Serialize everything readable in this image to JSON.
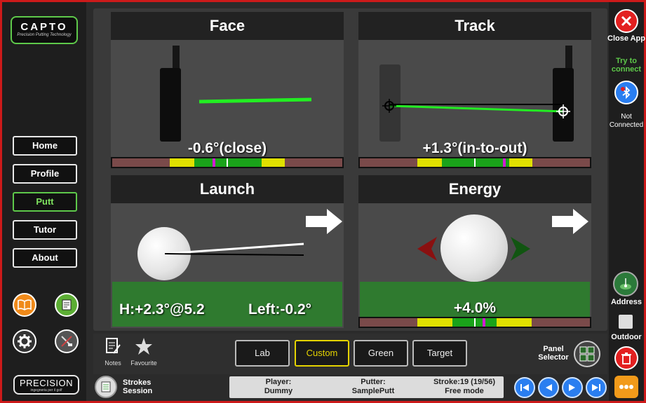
{
  "sidebar": {
    "logo": {
      "brand": "CAPTO",
      "tagline": "Precision Putting Technology"
    },
    "nav": [
      {
        "label": "Home",
        "active": false
      },
      {
        "label": "Profile",
        "active": false
      },
      {
        "label": "Putt",
        "active": true
      },
      {
        "label": "Tutor",
        "active": false
      },
      {
        "label": "About",
        "active": false
      }
    ],
    "footer_logo": {
      "brand": "PRECISION",
      "tagline": "ingegneria per il golf"
    }
  },
  "panels": {
    "face": {
      "title": "Face",
      "value": "-0.6°(close)"
    },
    "track": {
      "title": "Track",
      "value": "+1.3°(in-to-out)"
    },
    "launch": {
      "title": "Launch",
      "value_h": "H:+2.3°@5.2",
      "value_left": "Left:-0.2°"
    },
    "energy": {
      "title": "Energy",
      "value": "+4.0%"
    }
  },
  "toolbar": {
    "notes_label": "Notes",
    "favourite_label": "Favourite",
    "tabs": [
      {
        "label": "Lab",
        "active": false
      },
      {
        "label": "Custom",
        "active": true
      },
      {
        "label": "Green",
        "active": false
      },
      {
        "label": "Target",
        "active": false
      }
    ],
    "panel_selector_label": "Panel Selector"
  },
  "session": {
    "label": "Strokes Session"
  },
  "info": {
    "player_label": "Player:",
    "player_value": "Dummy",
    "putter_label": "Putter:",
    "putter_value": "SamplePutt",
    "stroke_label": "Stroke:19 (19/56)",
    "mode_value": "Free mode"
  },
  "right": {
    "close_label": "Close App",
    "try_connect_label": "Try to connect",
    "status_label": "Not Connected",
    "address_label": "Address",
    "outdoor_label": "Outdoor"
  },
  "colors": {
    "accent_green": "#5ec94a",
    "frame_red": "#cc1a1a",
    "bar_yellow": "#e0e000",
    "bar_green": "#1aa31a",
    "bar_red": "#7a4a4a",
    "marker_magenta": "#d21ad2",
    "nav_blue": "#2a7ef0",
    "highlight_yellow": "#e5d400"
  },
  "icons": {
    "notes": "notes-icon",
    "favourite": "star-icon",
    "close": "close-icon",
    "connect": "bluetooth-icon",
    "address": "address-icon",
    "outdoor": "checkbox-icon",
    "delete": "trash-icon",
    "more": "more-icon"
  }
}
